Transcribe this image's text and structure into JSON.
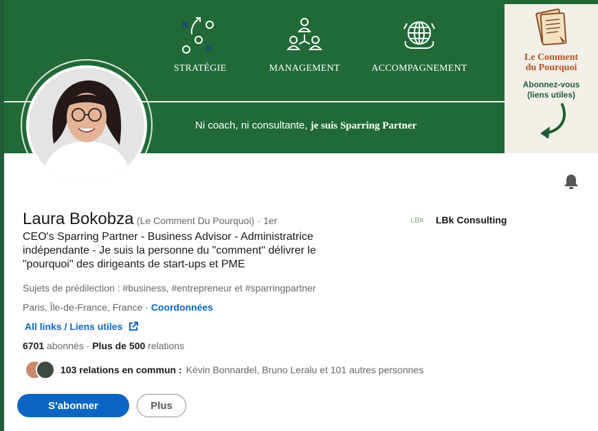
{
  "banner": {
    "pillars": [
      {
        "label": "STRATÉGIE",
        "icon": "strategy-play-icon"
      },
      {
        "label": "MANAGEMENT",
        "icon": "team-hierarchy-icon"
      },
      {
        "label": "ACCOMPAGNEMENT",
        "icon": "globe-icon"
      }
    ],
    "tagline_prefix": "Ni coach, ni consultante,",
    "tagline_emphasis": "je suis Sparring Partner",
    "promo": {
      "title_line1": "Le Comment",
      "title_line2": "du Pourquoi",
      "cta_line1": "Abonnez-vous",
      "cta_line2": "(liens utiles)",
      "icon": "document-icon"
    }
  },
  "profile": {
    "name": "Laura Bokobza",
    "pronoun": "(Le Comment Du Pourquoi)",
    "degree": "· 1er",
    "headline": "CEO's Sparring Partner - Business Advisor - Administratrice indépendante - Je suis la personne du \"comment\" délivrer le \"pourquoi\" des dirigeants de start-ups et PME",
    "topics": "Sujets de prédilection : #business, #entrepreneur et #sparringpartner",
    "location": "Paris, Île-de-France, France ·",
    "contact_link": "Coordonnées",
    "links_label": "All links / Liens utiles",
    "followers_count": "6701",
    "followers_label": "abonnés",
    "connections_prefix": "·",
    "connections_count": "Plus de 500",
    "connections_label": "relations",
    "mutual_bold": "103 relations en commun :",
    "mutual_rest": "Kévin Bonnardel, Bruno Leralu et 101 autres personnes"
  },
  "company": {
    "name": "LBk Consulting",
    "logo_text": "LBK"
  },
  "actions": {
    "follow": "S'abonner",
    "more": "Plus"
  },
  "colors": {
    "banner": "#216a38",
    "accent": "#0a66c2",
    "promo_title": "#b35424"
  }
}
